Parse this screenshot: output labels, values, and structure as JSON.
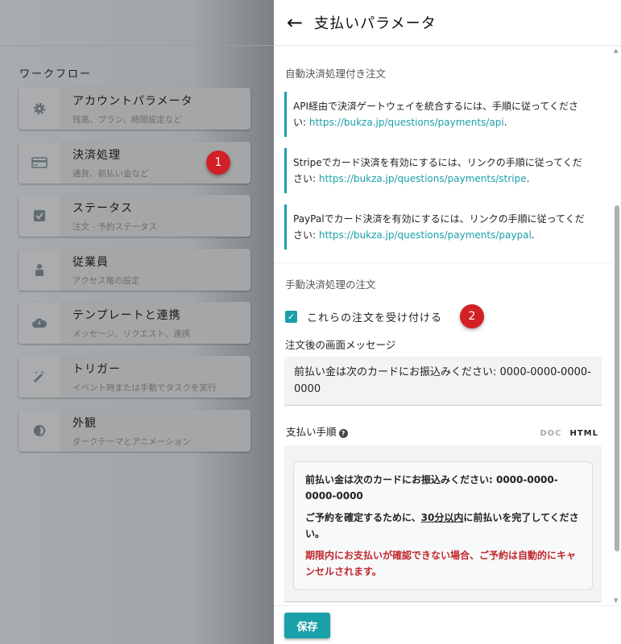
{
  "sidebar": {
    "section_title": "ワークフロー",
    "items": [
      {
        "title": "アカウントパラメータ",
        "subtitle": "残高、プラン、時間設定など",
        "icon": "gear-icon"
      },
      {
        "title": "決済処理",
        "subtitle": "通貨、前払い金など",
        "icon": "credit-card-icon"
      },
      {
        "title": "ステータス",
        "subtitle": "注文 - 予約ステータス",
        "icon": "checkbox-icon"
      },
      {
        "title": "従業員",
        "subtitle": "アクセス権の設定",
        "icon": "user-icon"
      },
      {
        "title": "テンプレートと連携",
        "subtitle": "メッセージ、リクエスト、連携",
        "icon": "cloud-bolt-icon"
      },
      {
        "title": "トリガー",
        "subtitle": "イベント時または手動でタスクを実行",
        "icon": "magic-wand-icon"
      },
      {
        "title": "外観",
        "subtitle": "ダークテーマとアニメーション",
        "icon": "contrast-icon"
      }
    ]
  },
  "badges": [
    "1",
    "2"
  ],
  "panel": {
    "back": "←",
    "title": "支払いパラメータ",
    "auto_section": "自動決済処理付き注文",
    "notes": [
      {
        "text": "API経由で決済ゲートウェイを統合するには、手順に従ってください: ",
        "link": "https://bukza.jp/questions/payments/api",
        "end": "."
      },
      {
        "text": "Stripeでカード決済を有効にするには、リンクの手順に従ってください: ",
        "link": "https://bukza.jp/questions/payments/stripe",
        "end": "."
      },
      {
        "text": "PayPalでカード決済を有効にするには、リンクの手順に従ってください: ",
        "link": "https://bukza.jp/questions/payments/paypal",
        "end": "."
      }
    ],
    "manual_section": "手動決済処理の注文",
    "accept_label": "これらの注文を受け付ける",
    "accept_checked": true,
    "message_label": "注文後の画面メッセージ",
    "message_value": "前払い金は次のカードにお振込みください: 0000-0000-0000-0000",
    "procedure_label": "支払い手順",
    "help": "?",
    "format_doc": "DOC",
    "format_html": "HTML",
    "proc_p1": "前払い金は次のカードにお振込みください: 0000-0000-0000-0000",
    "proc_p2_a": "ご予約を確定するために、",
    "proc_p2_u": "30分以内",
    "proc_p2_b": "に前払いを完了してください。",
    "proc_p3": "期限内にお支払いが確認できない場合、ご予約は自動的にキャンセルされます。",
    "save": "保存"
  },
  "colors": {
    "accent": "#1aa0a8",
    "badge": "#d32027",
    "warning": "#c0272d"
  }
}
